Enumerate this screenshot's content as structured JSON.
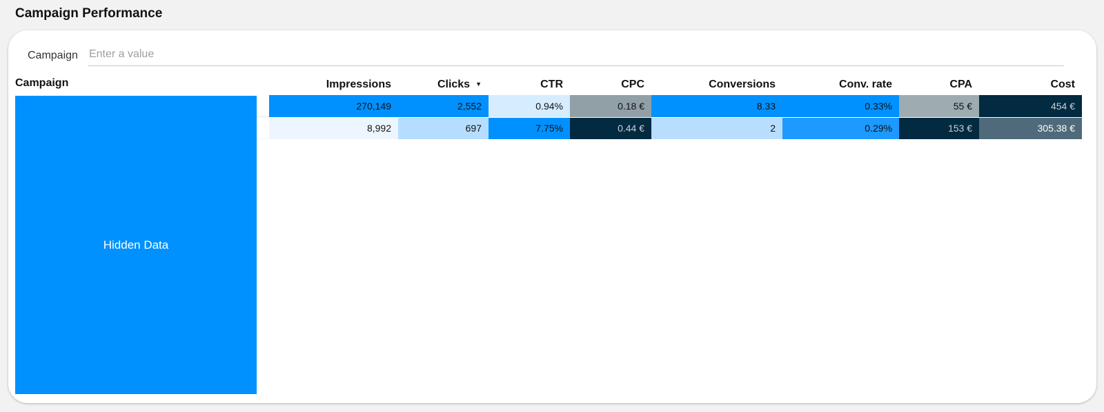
{
  "page": {
    "title": "Campaign Performance"
  },
  "filter": {
    "label": "Campaign",
    "placeholder": "Enter a value",
    "value": ""
  },
  "table": {
    "campaign_header": "Campaign",
    "hidden_label": "Hidden Data",
    "columns": [
      "Impressions",
      "Clicks",
      "CTR",
      "CPC",
      "Conversions",
      "Conv. rate",
      "CPA",
      "Cost"
    ],
    "sorted_column": "Clicks",
    "sort_direction": "descending",
    "rows": [
      {
        "cells": [
          "270,149",
          "2,552",
          "0.94%",
          "0.18 €",
          "8.33",
          "0.33%",
          "55 €",
          "454 €"
        ],
        "colors": [
          "#0091ff",
          "#0091ff",
          "#d6ecff",
          "#919fa6",
          "#0091ff",
          "#0091ff",
          "#9eabb1",
          "#022a40"
        ],
        "text_colors": [
          "#111111",
          "#111111",
          "#111111",
          "#111111",
          "#111111",
          "#111111",
          "#111111",
          "#c8d0d6"
        ]
      },
      {
        "cells": [
          "8,992",
          "697",
          "7.75%",
          "0.44 €",
          "2",
          "0.29%",
          "153 €",
          "305.38 €"
        ],
        "colors": [
          "#edf6ff",
          "#b5ddff",
          "#0091ff",
          "#022a40",
          "#b8ddff",
          "#1d99ff",
          "#022a40",
          "#4f6a7a"
        ],
        "text_colors": [
          "#111111",
          "#111111",
          "#111111",
          "#c8d0d6",
          "#111111",
          "#111111",
          "#c8d0d6",
          "#ffffff"
        ]
      }
    ]
  }
}
